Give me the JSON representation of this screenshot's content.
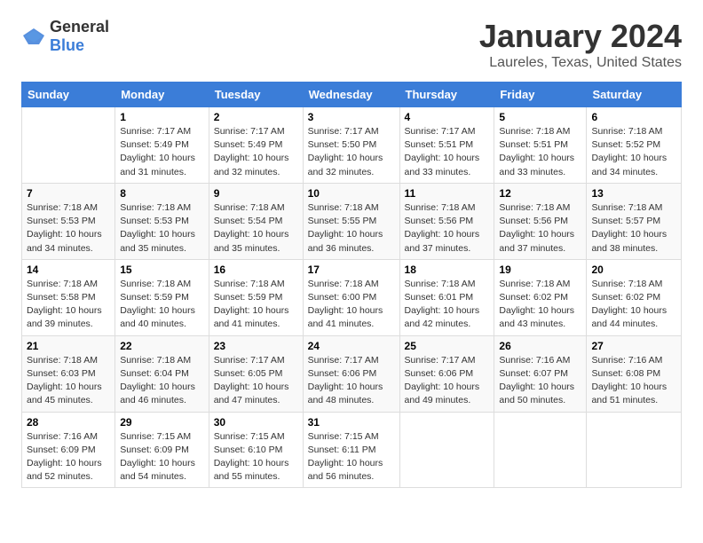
{
  "logo": {
    "general": "General",
    "blue": "Blue"
  },
  "header": {
    "month": "January 2024",
    "location": "Laureles, Texas, United States"
  },
  "weekdays": [
    "Sunday",
    "Monday",
    "Tuesday",
    "Wednesday",
    "Thursday",
    "Friday",
    "Saturday"
  ],
  "weeks": [
    [
      {
        "day": "",
        "info": ""
      },
      {
        "day": "1",
        "info": "Sunrise: 7:17 AM\nSunset: 5:49 PM\nDaylight: 10 hours\nand 31 minutes."
      },
      {
        "day": "2",
        "info": "Sunrise: 7:17 AM\nSunset: 5:49 PM\nDaylight: 10 hours\nand 32 minutes."
      },
      {
        "day": "3",
        "info": "Sunrise: 7:17 AM\nSunset: 5:50 PM\nDaylight: 10 hours\nand 32 minutes."
      },
      {
        "day": "4",
        "info": "Sunrise: 7:17 AM\nSunset: 5:51 PM\nDaylight: 10 hours\nand 33 minutes."
      },
      {
        "day": "5",
        "info": "Sunrise: 7:18 AM\nSunset: 5:51 PM\nDaylight: 10 hours\nand 33 minutes."
      },
      {
        "day": "6",
        "info": "Sunrise: 7:18 AM\nSunset: 5:52 PM\nDaylight: 10 hours\nand 34 minutes."
      }
    ],
    [
      {
        "day": "7",
        "info": "Sunrise: 7:18 AM\nSunset: 5:53 PM\nDaylight: 10 hours\nand 34 minutes."
      },
      {
        "day": "8",
        "info": "Sunrise: 7:18 AM\nSunset: 5:53 PM\nDaylight: 10 hours\nand 35 minutes."
      },
      {
        "day": "9",
        "info": "Sunrise: 7:18 AM\nSunset: 5:54 PM\nDaylight: 10 hours\nand 35 minutes."
      },
      {
        "day": "10",
        "info": "Sunrise: 7:18 AM\nSunset: 5:55 PM\nDaylight: 10 hours\nand 36 minutes."
      },
      {
        "day": "11",
        "info": "Sunrise: 7:18 AM\nSunset: 5:56 PM\nDaylight: 10 hours\nand 37 minutes."
      },
      {
        "day": "12",
        "info": "Sunrise: 7:18 AM\nSunset: 5:56 PM\nDaylight: 10 hours\nand 37 minutes."
      },
      {
        "day": "13",
        "info": "Sunrise: 7:18 AM\nSunset: 5:57 PM\nDaylight: 10 hours\nand 38 minutes."
      }
    ],
    [
      {
        "day": "14",
        "info": "Sunrise: 7:18 AM\nSunset: 5:58 PM\nDaylight: 10 hours\nand 39 minutes."
      },
      {
        "day": "15",
        "info": "Sunrise: 7:18 AM\nSunset: 5:59 PM\nDaylight: 10 hours\nand 40 minutes."
      },
      {
        "day": "16",
        "info": "Sunrise: 7:18 AM\nSunset: 5:59 PM\nDaylight: 10 hours\nand 41 minutes."
      },
      {
        "day": "17",
        "info": "Sunrise: 7:18 AM\nSunset: 6:00 PM\nDaylight: 10 hours\nand 41 minutes."
      },
      {
        "day": "18",
        "info": "Sunrise: 7:18 AM\nSunset: 6:01 PM\nDaylight: 10 hours\nand 42 minutes."
      },
      {
        "day": "19",
        "info": "Sunrise: 7:18 AM\nSunset: 6:02 PM\nDaylight: 10 hours\nand 43 minutes."
      },
      {
        "day": "20",
        "info": "Sunrise: 7:18 AM\nSunset: 6:02 PM\nDaylight: 10 hours\nand 44 minutes."
      }
    ],
    [
      {
        "day": "21",
        "info": "Sunrise: 7:18 AM\nSunset: 6:03 PM\nDaylight: 10 hours\nand 45 minutes."
      },
      {
        "day": "22",
        "info": "Sunrise: 7:18 AM\nSunset: 6:04 PM\nDaylight: 10 hours\nand 46 minutes."
      },
      {
        "day": "23",
        "info": "Sunrise: 7:17 AM\nSunset: 6:05 PM\nDaylight: 10 hours\nand 47 minutes."
      },
      {
        "day": "24",
        "info": "Sunrise: 7:17 AM\nSunset: 6:06 PM\nDaylight: 10 hours\nand 48 minutes."
      },
      {
        "day": "25",
        "info": "Sunrise: 7:17 AM\nSunset: 6:06 PM\nDaylight: 10 hours\nand 49 minutes."
      },
      {
        "day": "26",
        "info": "Sunrise: 7:16 AM\nSunset: 6:07 PM\nDaylight: 10 hours\nand 50 minutes."
      },
      {
        "day": "27",
        "info": "Sunrise: 7:16 AM\nSunset: 6:08 PM\nDaylight: 10 hours\nand 51 minutes."
      }
    ],
    [
      {
        "day": "28",
        "info": "Sunrise: 7:16 AM\nSunset: 6:09 PM\nDaylight: 10 hours\nand 52 minutes."
      },
      {
        "day": "29",
        "info": "Sunrise: 7:15 AM\nSunset: 6:09 PM\nDaylight: 10 hours\nand 54 minutes."
      },
      {
        "day": "30",
        "info": "Sunrise: 7:15 AM\nSunset: 6:10 PM\nDaylight: 10 hours\nand 55 minutes."
      },
      {
        "day": "31",
        "info": "Sunrise: 7:15 AM\nSunset: 6:11 PM\nDaylight: 10 hours\nand 56 minutes."
      },
      {
        "day": "",
        "info": ""
      },
      {
        "day": "",
        "info": ""
      },
      {
        "day": "",
        "info": ""
      }
    ]
  ]
}
